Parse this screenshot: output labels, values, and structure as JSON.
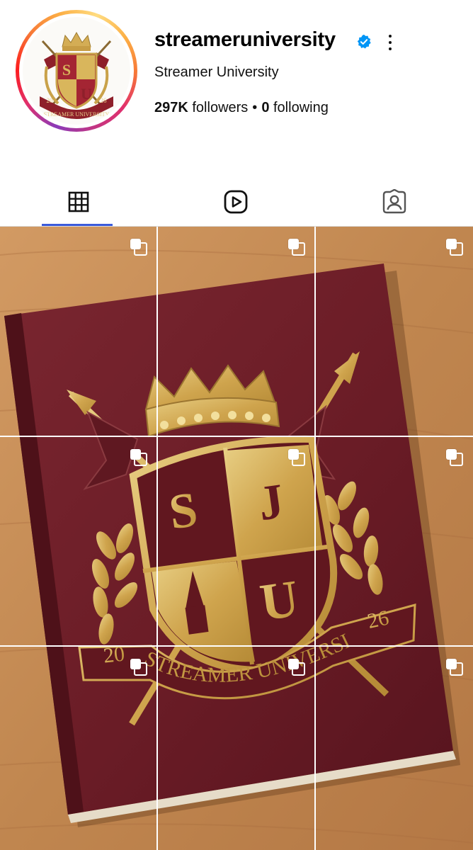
{
  "profile": {
    "username": "streameruniversity",
    "display_name": "Streamer University",
    "followers_count": "297K",
    "followers_label": "followers",
    "separator": "•",
    "following_count": "0",
    "following_label": "following",
    "verified": true,
    "avatar_text": {
      "left_year": "20",
      "right_year": "26",
      "banner": "STREAMER UNIVERSITY",
      "letter_s": "S",
      "letter_u": "U"
    }
  },
  "tabs": [
    {
      "name": "posts",
      "icon": "grid-icon",
      "active": true
    },
    {
      "name": "reels",
      "icon": "reels-icon",
      "active": false
    },
    {
      "name": "tagged",
      "icon": "tagged-icon",
      "active": false
    }
  ],
  "grid": {
    "rows": 3,
    "columns": 3,
    "cell_icon": "carousel-icon",
    "image_text": {
      "left_year": "20",
      "right_year": "26",
      "banner": "STREAMER UNIVERSITY",
      "letter_s": "S",
      "letter_j": "J",
      "letter_u": "U"
    }
  },
  "colors": {
    "accent": "#3b5bdb",
    "verified": "#0095f6",
    "book": "#6e1d27",
    "gold": "#d9b65c",
    "wood": "#c58a55"
  }
}
